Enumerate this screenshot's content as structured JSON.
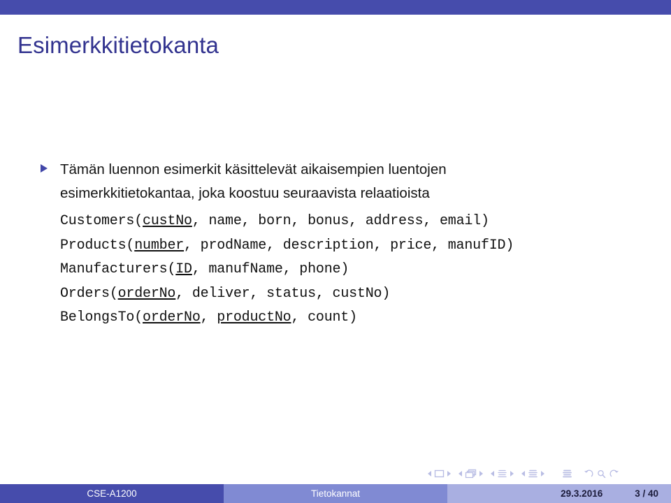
{
  "theme": {
    "topbar_color": "#464cac",
    "title_color": "#32338f",
    "bullet_color": "#4146a8",
    "footer_author_bg": "#464cac",
    "footer_title_bg": "#808ad3",
    "footer_meta_bg": "#a9afe1",
    "nav_symbol_color": "#b9bde4"
  },
  "slide": {
    "title": "Esimerkkitietokanta",
    "bullet": "Tämän luennon esimerkit käsittelevät aikaisempien luentojen esimerkkitietokantaa, joka koostuu seuraavista relaatioista",
    "relations": [
      {
        "name": "Customers",
        "attributes": [
          {
            "text": "custNo",
            "key": true
          },
          {
            "text": "name",
            "key": false
          },
          {
            "text": "born",
            "key": false
          },
          {
            "text": "bonus",
            "key": false
          },
          {
            "text": "address",
            "key": false
          },
          {
            "text": "email",
            "key": false
          }
        ]
      },
      {
        "name": "Products",
        "attributes": [
          {
            "text": "number",
            "key": true
          },
          {
            "text": "prodName",
            "key": false
          },
          {
            "text": "description",
            "key": false
          },
          {
            "text": "price",
            "key": false
          },
          {
            "text": "manufID",
            "key": false
          }
        ]
      },
      {
        "name": "Manufacturers",
        "attributes": [
          {
            "text": "ID",
            "key": true
          },
          {
            "text": "manufName",
            "key": false
          },
          {
            "text": "phone",
            "key": false
          }
        ]
      },
      {
        "name": "Orders",
        "attributes": [
          {
            "text": "orderNo",
            "key": true
          },
          {
            "text": "deliver",
            "key": false
          },
          {
            "text": "status",
            "key": false
          },
          {
            "text": "custNo",
            "key": false
          }
        ]
      },
      {
        "name": "BelongsTo",
        "attributes": [
          {
            "text": "orderNo",
            "key": true
          },
          {
            "text": "productNo",
            "key": true
          },
          {
            "text": "count",
            "key": false
          }
        ]
      }
    ]
  },
  "navigation": {
    "groups": [
      {
        "icon": "slide-icon",
        "prev": "previous-slide",
        "next": "next-slide"
      },
      {
        "icon": "frame-icon",
        "prev": "previous-frame",
        "next": "next-frame"
      },
      {
        "icon": "subsection-icon",
        "prev": "previous-subsection",
        "next": "next-subsection"
      },
      {
        "icon": "section-icon",
        "prev": "previous-section",
        "next": "next-section"
      }
    ],
    "presentation_icon": "presentation-icon",
    "tools": [
      "back-icon",
      "search-icon",
      "forward-icon"
    ]
  },
  "footer": {
    "author": "CSE-A1200",
    "title": "Tietokannat",
    "date": "29.3.2016",
    "page": "3 / 40"
  }
}
